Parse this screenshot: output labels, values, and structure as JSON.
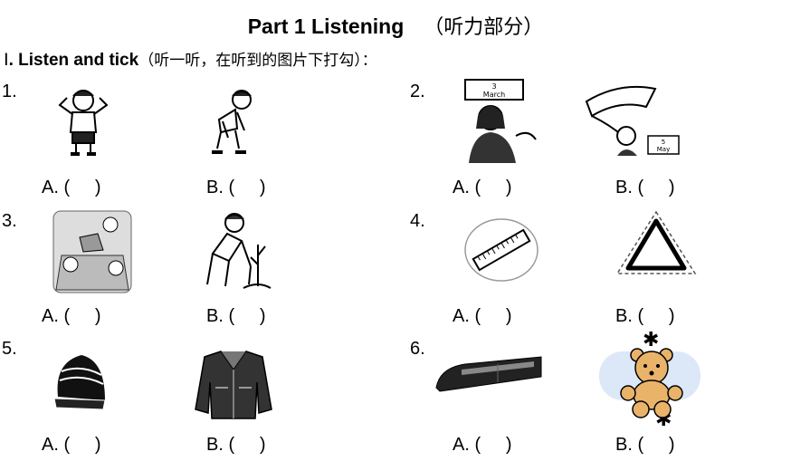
{
  "title": {
    "en": "Part 1 Listening",
    "cn": "（听力部分）"
  },
  "instruction": {
    "roman": "Ⅰ",
    "en": ". Listen and tick",
    "cn": "（听一听，在听到的图片下打勾）："
  },
  "questions": [
    {
      "number": "1.",
      "pictures": [
        "boy-standing-icon",
        "boy-bending-icon"
      ]
    },
    {
      "number": "2.",
      "pictures": [
        "girl-march-calendar-icon",
        "boy-kite-may-icon"
      ],
      "calendar_a": [
        "3",
        "March"
      ],
      "calendar_b": [
        "5",
        "May"
      ]
    },
    {
      "number": "3.",
      "pictures": [
        "picnic-children-icon",
        "planting-tree-icon"
      ]
    },
    {
      "number": "4.",
      "pictures": [
        "ruler-circle-icon",
        "triangle-icon"
      ]
    },
    {
      "number": "5.",
      "pictures": [
        "knit-hat-icon",
        "leather-jacket-icon"
      ]
    },
    {
      "number": "6.",
      "pictures": [
        "train-icon",
        "teddy-bear-icon"
      ]
    }
  ],
  "options": {
    "a": "A. (     )",
    "b": "B. (     )"
  }
}
